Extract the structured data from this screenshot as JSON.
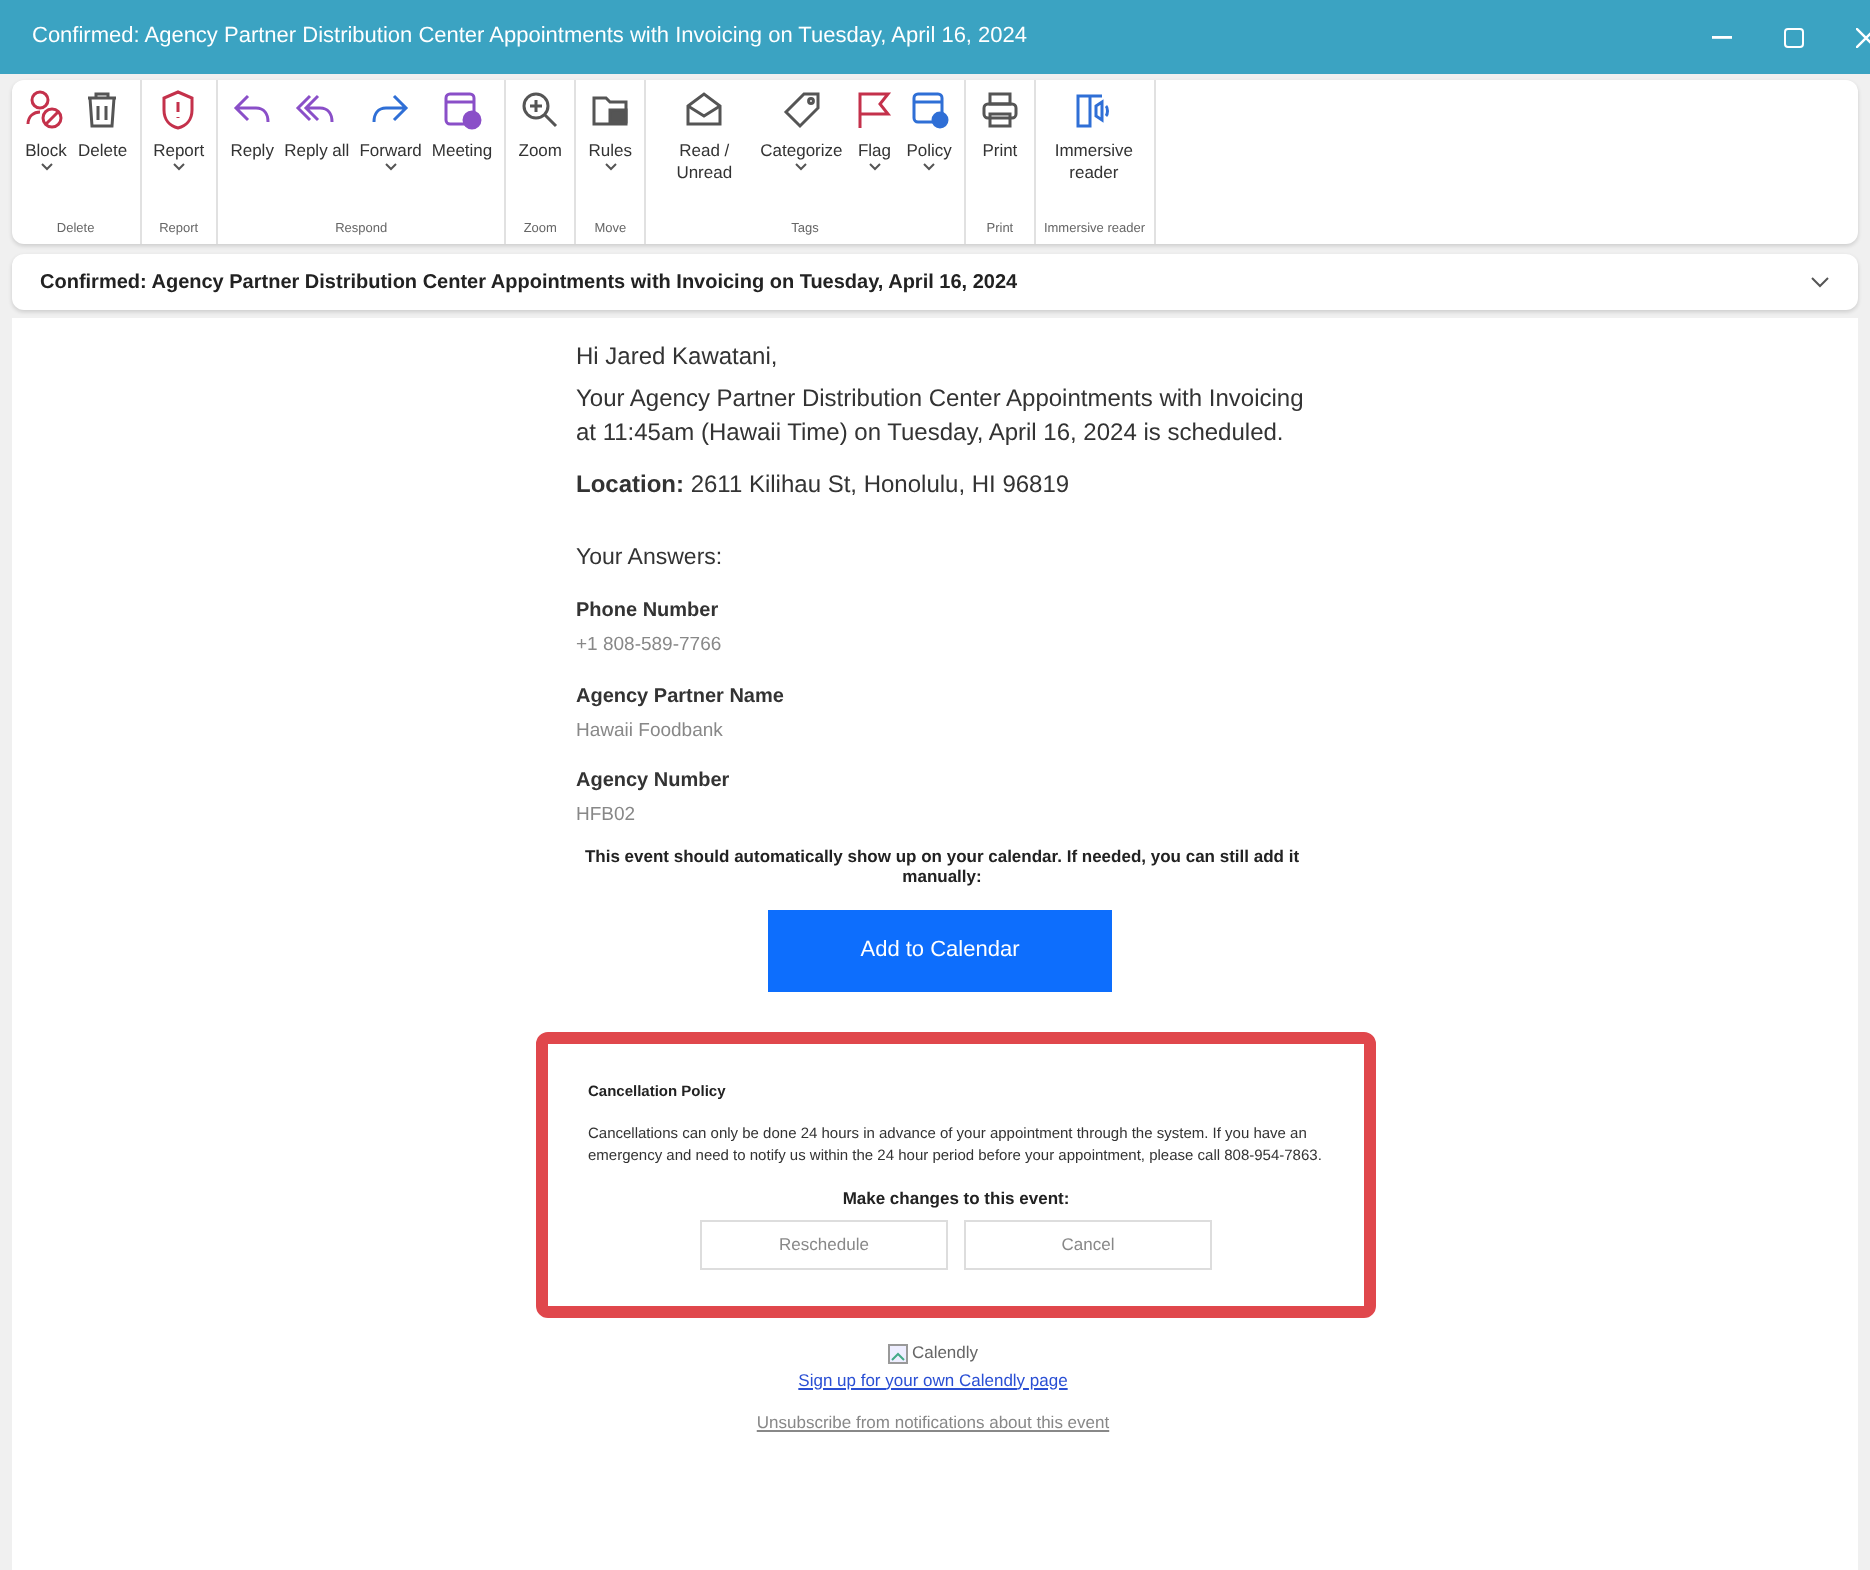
{
  "window": {
    "title": "Confirmed: Agency Partner Distribution Center Appointments with Invoicing on Tuesday, April 16, 2024"
  },
  "ribbon": [
    {
      "label": "Delete",
      "buttons": [
        {
          "kind": "block",
          "label": "Block",
          "dropdown": true
        },
        {
          "kind": "delete",
          "label": "Delete",
          "dropdown": false
        }
      ]
    },
    {
      "label": "Report",
      "buttons": [
        {
          "kind": "report",
          "label": "Report",
          "dropdown": true
        }
      ]
    },
    {
      "label": "Respond",
      "buttons": [
        {
          "kind": "reply",
          "label": "Reply",
          "dropdown": false
        },
        {
          "kind": "replyall",
          "label": "Reply all",
          "dropdown": false
        },
        {
          "kind": "forward",
          "label": "Forward",
          "dropdown": true
        },
        {
          "kind": "meeting",
          "label": "Meeting",
          "dropdown": false
        }
      ]
    },
    {
      "label": "Zoom",
      "buttons": [
        {
          "kind": "zoom",
          "label": "Zoom",
          "dropdown": false
        }
      ]
    },
    {
      "label": "Move",
      "buttons": [
        {
          "kind": "rules",
          "label": "Rules",
          "dropdown": true
        }
      ]
    },
    {
      "label": "Tags",
      "buttons": [
        {
          "kind": "read",
          "label": "Read / Unread",
          "dropdown": false
        },
        {
          "kind": "categorize",
          "label": "Categorize",
          "dropdown": true
        },
        {
          "kind": "flag",
          "label": "Flag",
          "dropdown": true
        },
        {
          "kind": "policy",
          "label": "Policy",
          "dropdown": true
        }
      ]
    },
    {
      "label": "Print",
      "buttons": [
        {
          "kind": "print",
          "label": "Print",
          "dropdown": false
        }
      ]
    },
    {
      "label": "Immersive reader",
      "buttons": [
        {
          "kind": "immersive",
          "label": "Immersive reader",
          "dropdown": false
        }
      ]
    }
  ],
  "subject": {
    "text": "Confirmed: Agency Partner Distribution Center Appointments with Invoicing on Tuesday, April 16, 2024",
    "expanded": false
  },
  "email": {
    "greeting": "Hi Jared Kawatani,",
    "intro": "Your Agency Partner Distribution Center Appointments with Invoicing at 11:45am (Hawaii Time) on Tuesday, April 16, 2024 is scheduled.",
    "location": "**Location:** 2611 Kilihau St, Honolulu, HI 96819",
    "answers_heading": "Your Answers:",
    "answers": [
      {
        "question": "Phone Number",
        "answer": "+1 808-589-7766"
      },
      {
        "question": "Agency Partner Name",
        "answer": "Hawaii Foodbank"
      },
      {
        "question": "Agency Number",
        "answer": "HFB02"
      }
    ],
    "calendar_note": "This event should automatically show up on your calendar. If needed, you can still add it manually:",
    "calendar_button": "Add to Calendar",
    "cancellation": {
      "highlighted": true,
      "title": "Cancellation Policy",
      "text": "Cancellations can only be done 24 hours in advance of your appointment through the system. If you have an emergency and need to notify us within the 24 hour period before your appointment, please call 808-954-7863.",
      "changes_label": "Make changes to this event:",
      "buttons": [
        "Reschedule",
        "Cancel"
      ]
    },
    "logo_alt": "Calendly",
    "signup_link": "Sign up for your own Calendly page",
    "unsubscribe": "Unsubscribe from notifications about this event"
  }
}
